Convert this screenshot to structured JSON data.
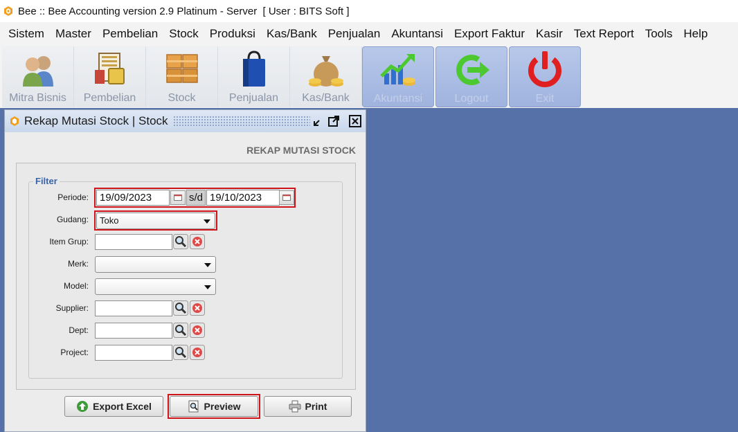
{
  "window": {
    "title": "Bee :: Bee Accounting version 2.9 Platinum - Server  [ User : BITS Soft ]"
  },
  "menu": [
    "Sistem",
    "Master",
    "Pembelian",
    "Stock",
    "Produksi",
    "Kas/Bank",
    "Penjualan",
    "Akuntansi",
    "Export Faktur",
    "Kasir",
    "Text Report",
    "Tools",
    "Help"
  ],
  "toolbar": {
    "buttons": [
      {
        "label": "Mitra Bisnis",
        "icon": "users-icon"
      },
      {
        "label": "Pembelian",
        "icon": "purchase-book-icon"
      },
      {
        "label": "Stock",
        "icon": "boxes-icon"
      },
      {
        "label": "Penjualan",
        "icon": "shopping-bag-icon"
      },
      {
        "label": "Kas/Bank",
        "icon": "money-bag-icon"
      },
      {
        "label": "Akuntansi",
        "icon": "chart-growth-icon"
      },
      {
        "label": "Logout",
        "icon": "logout-arrow-icon"
      },
      {
        "label": "Exit",
        "icon": "power-icon"
      }
    ]
  },
  "form": {
    "window_title": "Rekap Mutasi Stock | Stock",
    "heading": "REKAP MUTASI STOCK",
    "filter_legend": "Filter",
    "labels": {
      "periode": "Periode:",
      "gudang": "Gudang:",
      "item_grup": "Item Grup:",
      "merk": "Merk:",
      "model": "Model:",
      "supplier": "Supplier:",
      "dept": "Dept:",
      "project": "Project:"
    },
    "periode_from": "19/09/2023",
    "periode_sep": "s/d",
    "periode_to": "19/10/2023",
    "gudang_value": "Toko",
    "merk_value": "",
    "model_value": "",
    "item_grup_value": "",
    "supplier_value": "",
    "dept_value": "",
    "project_value": ""
  },
  "actions": {
    "export_excel": "Export Excel",
    "preview": "Preview",
    "print": "Print"
  },
  "colors": {
    "desktop": "#5670a8",
    "highlight": "#d0121b",
    "legend": "#3a63a8"
  }
}
